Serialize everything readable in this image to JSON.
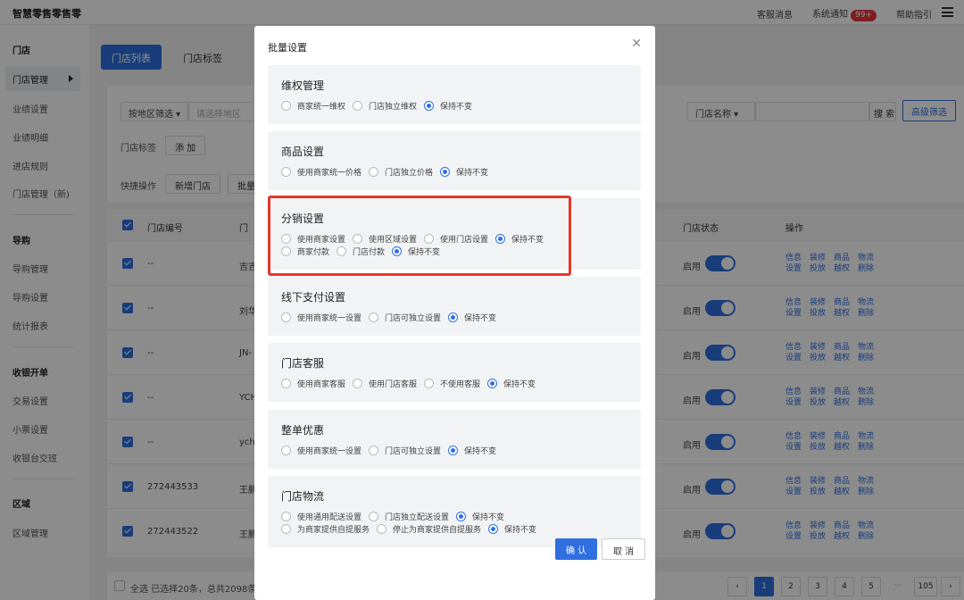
{
  "app": {
    "title": "智慧零售零售零"
  },
  "topnav": {
    "service": "客服消息",
    "notify": "系统通知",
    "notify_badge": "99+",
    "help": "帮助指引"
  },
  "sidebar": {
    "sections": [
      {
        "title": "门店",
        "items": [
          "门店管理",
          "业绩设置",
          "业绩明细",
          "进店规则",
          "门店管理（新)"
        ]
      },
      {
        "title": "导购",
        "items": [
          "导购管理",
          "导购设置",
          "统计报表"
        ]
      },
      {
        "title": "收银开单",
        "items": [
          "交易设置",
          "小票设置",
          "收银台交班"
        ]
      },
      {
        "title": "区域",
        "items": [
          "区域管理"
        ]
      }
    ]
  },
  "tabs": {
    "list": "门店列表",
    "tags": "门店标签"
  },
  "filters": {
    "region_select": "按地区筛选",
    "region_placeholder": "请选择地区",
    "store_name_select": "门店名称",
    "search": "搜 索",
    "advanced": "高级筛选",
    "tag_label": "门店标签",
    "add": "添 加",
    "quick_label": "快捷操作",
    "new_store": "新增门店",
    "batch": "批量"
  },
  "table": {
    "headers": {
      "id": "门店编号",
      "name": "门",
      "status": "门店状态",
      "ops": "操作"
    },
    "rows": [
      {
        "id": "--",
        "name": "吉吉",
        "status": "启用"
      },
      {
        "id": "--",
        "name": "刘华",
        "status": "启用"
      },
      {
        "id": "--",
        "name": "JN-",
        "status": "启用"
      },
      {
        "id": "--",
        "name": "YCH",
        "status": "启用"
      },
      {
        "id": "--",
        "name": "ych",
        "status": "启用"
      },
      {
        "id": "272443533",
        "name": "王鹏",
        "status": "启用"
      },
      {
        "id": "272443522",
        "name": "王鹏",
        "status": "启用"
      }
    ],
    "ops_line1": [
      "信息",
      "装修",
      "商品",
      "物流"
    ],
    "ops_line2": [
      "设置",
      "投放",
      "越权",
      "删除"
    ]
  },
  "footer": {
    "text": "全选  已选择20条，总共2098条 当"
  },
  "pagination": {
    "pages": [
      "1",
      "2",
      "3",
      "4",
      "5",
      "···",
      "105"
    ],
    "current": "1"
  },
  "modal": {
    "title": "批量设置",
    "confirm": "确 认",
    "cancel": "取 消",
    "sections": [
      {
        "title": "维权管理",
        "rows": [
          [
            {
              "label": "商家统一维权",
              "checked": false
            },
            {
              "label": "门店独立维权",
              "checked": false
            },
            {
              "label": "保持不变",
              "checked": true
            }
          ]
        ]
      },
      {
        "title": "商品设置",
        "rows": [
          [
            {
              "label": "使用商家统一价格",
              "checked": false
            },
            {
              "label": "门店独立价格",
              "checked": false
            },
            {
              "label": "保持不变",
              "checked": true
            }
          ]
        ]
      },
      {
        "title": "分销设置",
        "rows": [
          [
            {
              "label": "使用商家设置",
              "checked": false
            },
            {
              "label": "使用区域设置",
              "checked": false
            },
            {
              "label": "使用门店设置",
              "checked": false
            },
            {
              "label": "保持不变",
              "checked": true
            }
          ],
          [
            {
              "label": "商家付款",
              "checked": false
            },
            {
              "label": "门店付款",
              "checked": false
            },
            {
              "label": "保持不变",
              "checked": true
            }
          ]
        ]
      },
      {
        "title": "线下支付设置",
        "rows": [
          [
            {
              "label": "使用商家统一设置",
              "checked": false
            },
            {
              "label": "门店可独立设置",
              "checked": false
            },
            {
              "label": "保持不变",
              "checked": true
            }
          ]
        ]
      },
      {
        "title": "门店客服",
        "rows": [
          [
            {
              "label": "使用商家客服",
              "checked": false
            },
            {
              "label": "使用门店客服",
              "checked": false
            },
            {
              "label": "不使用客服",
              "checked": false
            },
            {
              "label": "保持不变",
              "checked": true
            }
          ]
        ]
      },
      {
        "title": "整单优惠",
        "rows": [
          [
            {
              "label": "使用商家统一设置",
              "checked": false
            },
            {
              "label": "门店可独立设置",
              "checked": false
            },
            {
              "label": "保持不变",
              "checked": true
            }
          ]
        ]
      },
      {
        "title": "门店物流",
        "rows": [
          [
            {
              "label": "使用通用配送设置",
              "checked": false
            },
            {
              "label": "门店独立配送设置",
              "checked": false
            },
            {
              "label": "保持不变",
              "checked": true
            }
          ],
          [
            {
              "label": "为商家提供自提服务",
              "checked": false
            },
            {
              "label": "停止为商家提供自提服务",
              "checked": false
            },
            {
              "label": "保持不变",
              "checked": true
            }
          ]
        ]
      }
    ]
  },
  "colors": {
    "primary": "#2f6fe0",
    "highlight": "#e5382b",
    "badge": "#e5383b"
  }
}
